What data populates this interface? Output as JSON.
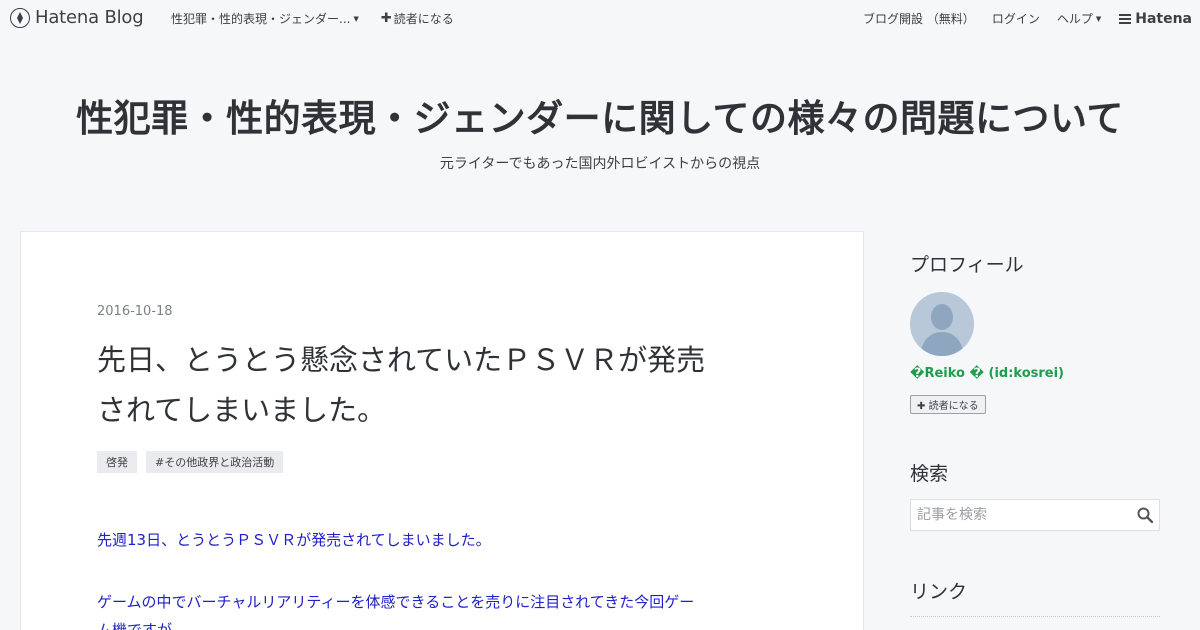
{
  "navbar": {
    "brand": "Hatena Blog",
    "blog_menu_label": "性犯罪・性的表現・ジェンダー...",
    "subscribe_label": "読者になる",
    "start_blog_label": "ブログ開設 （無料）",
    "login_label": "ログイン",
    "help_label": "ヘルプ",
    "hatena_label": "Hatena"
  },
  "blog": {
    "title": "性犯罪・性的表現・ジェンダーに関しての様々の問題について",
    "description": "元ライターでもあった国内外ロビイストからの視点"
  },
  "article": {
    "date": "2016-10-18",
    "title_line1": "先日、とうとう懸念されていたＰＳＶＲが発売",
    "title_line2": "されてしまいました。",
    "tags": [
      "啓発",
      "#その他政界と政治活動"
    ],
    "body_line1": "先週13日、とうとうＰＳＶＲが発売されてしまいました。",
    "body_line2": "ゲームの中でバーチャルリアリティーを体感できることを売りに注目されてきた今回ゲー",
    "body_line3": "ム機ですが、"
  },
  "sidebar": {
    "profile_heading": "プロフィール",
    "profile_name": "�Reiko � (id:kosrei)",
    "reader_button": "読者になる",
    "search_heading": "検索",
    "search_placeholder": "記事を検索",
    "links_heading": "リンク"
  },
  "colors": {
    "background": "#f6f7f9",
    "link_blue": "#2020c8",
    "profile_green": "#1e9d4c"
  }
}
